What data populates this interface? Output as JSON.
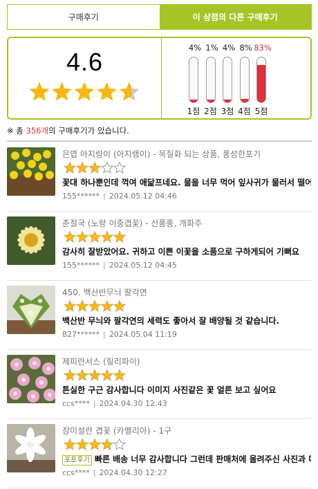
{
  "tabs": [
    {
      "label": "구매후기",
      "active": false
    },
    {
      "label": "이 상점의 다른 구매후기",
      "active": true
    }
  ],
  "summary": {
    "average": "4.6",
    "rating": 4.6,
    "distribution": [
      {
        "label": "1점",
        "percent_text": "4%",
        "percent": 4
      },
      {
        "label": "2점",
        "percent_text": "1%",
        "percent": 1
      },
      {
        "label": "3점",
        "percent_text": "4%",
        "percent": 4
      },
      {
        "label": "4점",
        "percent_text": "8%",
        "percent": 8
      },
      {
        "label": "5점",
        "percent_text": "83%",
        "percent": 83
      }
    ]
  },
  "count_line": {
    "prefix": "※ 총 ",
    "count": "356개",
    "suffix": "의 구매후기가 있습니다."
  },
  "reviews": [
    {
      "product": "은엽 아지랑이 (아지랭이) - 목질화 되는 상품, 풍성한포기",
      "rating": 3,
      "badge": "",
      "text": "꽃대 하나뿐인데 꺽여 애닯프네요. 물을 너무 먹어 잎사귀가 물러서 떨어지네요",
      "user": "155******",
      "date": "2024.05.12 04:46",
      "thumb": "yellow-flowers"
    },
    {
      "product": "춘절국 (노랑 이중겹꽃) - 신품종, 개화주",
      "rating": 5,
      "badge": "",
      "text": "감사히 잘받았어요. 귀하고 이쁜 이꽃을 소품으로 구하게되어 기뻐요",
      "user": "155******",
      "date": "2024.05.12 04:45",
      "thumb": "yellow-daisy"
    },
    {
      "product": "450. 백산반무늬 팔각연",
      "rating": 5,
      "badge": "",
      "text": "백산반 무늬와 팔각연의 세력도 좋아서 잘 배양될 것 같습니다.",
      "user": "827******",
      "date": "2024.05.04 11:19",
      "thumb": "variegated-leaf"
    },
    {
      "product": "제피란서스 (릴리파이)",
      "rating": 5,
      "badge": "",
      "text": "튼실한 구근 감사합니다 이미지 사진같은 꽃 얼른 보고 싶어요",
      "user": "ccs****",
      "date": "2024.04.30 12:43",
      "thumb": "pink-lilies"
    },
    {
      "product": "장미설란 겹꽃 (카멜리아) - 1구",
      "rating": 4,
      "badge": "포토후기",
      "text": "빠른 배송 너무 감사합니다 그런데 판매처에 올려주신 사진과 다른 것 같아요",
      "user": "ccs****",
      "date": "2024.04.30 12:27",
      "thumb": "white-camellia"
    }
  ],
  "colors": {
    "accent": "#a6c425",
    "star": "#f7b90f",
    "star_empty": "#c8c8c8",
    "bar_fill": "#e0303a",
    "count": "#e0303a"
  },
  "icons": {
    "star": "star-icon",
    "star_empty": "star-empty-icon",
    "star_half": "star-half-icon"
  }
}
